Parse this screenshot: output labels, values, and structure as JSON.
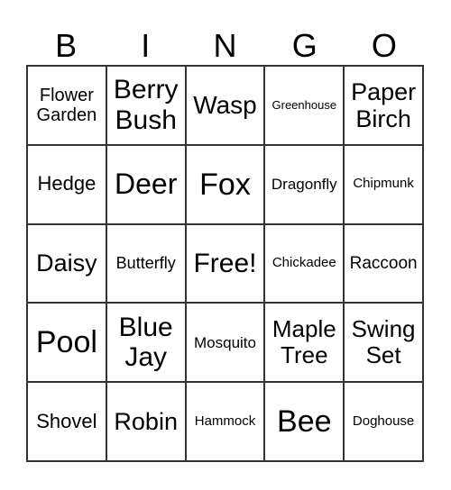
{
  "header": [
    "B",
    "I",
    "N",
    "G",
    "O"
  ],
  "cells": [
    [
      "Flower Garden",
      "Berry Bush",
      "Wasp",
      "Greenhouse",
      "Paper Birch"
    ],
    [
      "Hedge",
      "Deer",
      "Fox",
      "Dragonfly",
      "Chipmunk"
    ],
    [
      "Daisy",
      "Butterfly",
      "Free!",
      "Chickadee",
      "Raccoon"
    ],
    [
      "Pool",
      "Blue Jay",
      "Mosquito",
      "Maple Tree",
      "Swing Set"
    ],
    [
      "Shovel",
      "Robin",
      "Hammock",
      "Bee",
      "Doghouse"
    ]
  ]
}
